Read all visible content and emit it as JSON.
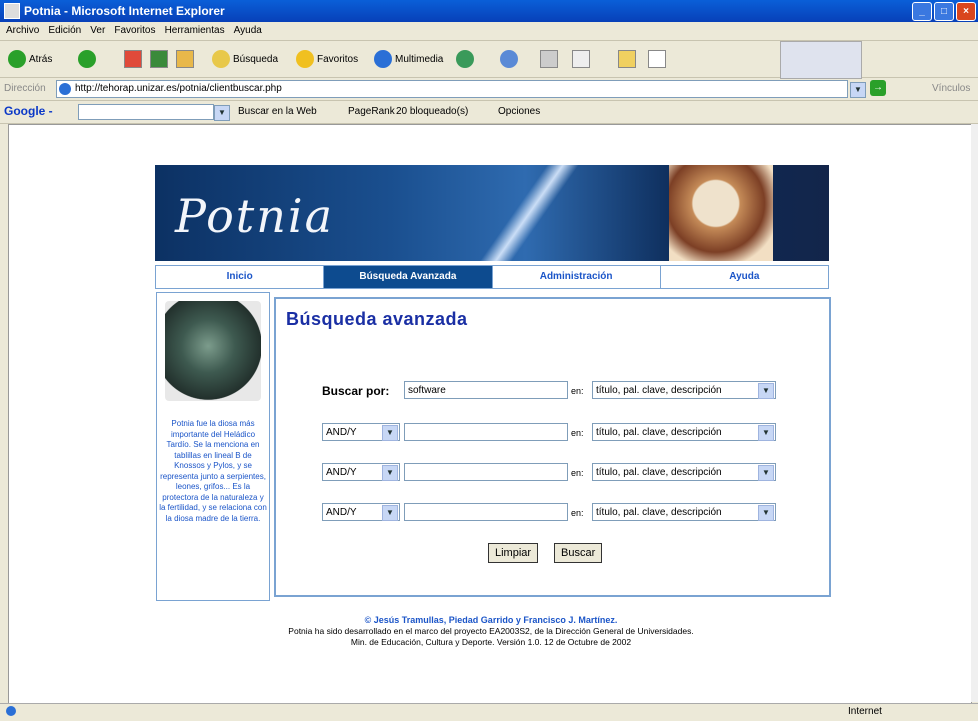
{
  "window": {
    "title": "Potnia - Microsoft Internet Explorer"
  },
  "menu": [
    "Archivo",
    "Edición",
    "Ver",
    "Favoritos",
    "Herramientas",
    "Ayuda"
  ],
  "toolbar": {
    "back": "Atrás",
    "search": "Búsqueda",
    "favorites": "Favoritos",
    "media": "Multimedia"
  },
  "address": {
    "label": "Dirección",
    "url": "http://tehorap.unizar.es/potnia/clientbuscar.php",
    "links": "Vínculos"
  },
  "google": {
    "logo": "Google -",
    "search_web": "Buscar en la Web",
    "pagerank": "PageRank",
    "blocked": "20 bloqueado(s)",
    "options": "Opciones"
  },
  "site": {
    "logo": "Potnia",
    "nav": [
      "Inicio",
      "Búsqueda Avanzada",
      "Administración",
      "Ayuda"
    ],
    "sidebar_text": "Potnia fue la diosa más importante del Heládico Tardío. Se la menciona en tablillas en lineal B de Knossos y Pylos, y se representa junto a serpientes, leones, grifos... Es la protectora de la naturaleza y la fertilidad, y se relaciona con la diosa madre de la tierra.",
    "heading": "Búsqueda avanzada",
    "search_label": "Buscar por:",
    "search_value": "software",
    "en": "en:",
    "field_option": "título, pal. clave, descripción",
    "op_option": "AND/Y",
    "clear": "Limpiar",
    "submit": "Buscar",
    "footer_authors": "© Jesús Tramullas, Piedad Garrido y Francisco J. Martínez.",
    "footer_line1": "Potnia ha sido desarrollado en el marco del proyecto EA2003S2, de la Dirección General de Universidades.",
    "footer_line2": "Min. de Educación, Cultura y Deporte. Versión 1.0. 12 de Octubre de 2002"
  },
  "status": {
    "zone": "Internet"
  }
}
